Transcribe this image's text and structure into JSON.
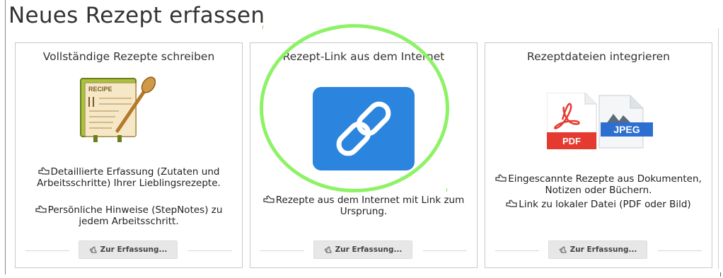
{
  "page": {
    "title": "Neues Rezept erfassen"
  },
  "cards": [
    {
      "title": "Vollständige Rezepte schreiben",
      "illustration": "recipe-card-with-spoon",
      "features": [
        "Detaillierte Erfassung (Zutaten und Arbeitsschritte) Ihrer Lieblingsrezepte.",
        "Persönliche Hinweise (StepNotes) zu jedem Arbeitsschritt."
      ],
      "button_label": "Zur Erfassung..."
    },
    {
      "title": "Rezept-Link aus dem Internet",
      "illustration": "link-chain-icon",
      "features": [
        "Rezepte aus dem Internet mit Link zum Ursprung."
      ],
      "button_label": "Zur Erfassung..."
    },
    {
      "title": "Rezeptdateien integrieren",
      "illustration": "pdf-jpeg-file-icons",
      "features": [
        "Eingescannte Rezepte aus Dokumenten, Notizen oder Büchern.",
        "Link zu lokaler Datei (PDF oder Bild)"
      ],
      "file_badges": [
        "PDF",
        "JPEG"
      ],
      "recipe_label": "RECIPE",
      "button_label": "Zur Erfassung..."
    }
  ],
  "colors": {
    "highlight_ring": "#8ef266",
    "link_tile": "#2b84dd",
    "pdf_red": "#e53a2f",
    "jpeg_blue": "#2c6fd0"
  },
  "corner_mark": "ı"
}
